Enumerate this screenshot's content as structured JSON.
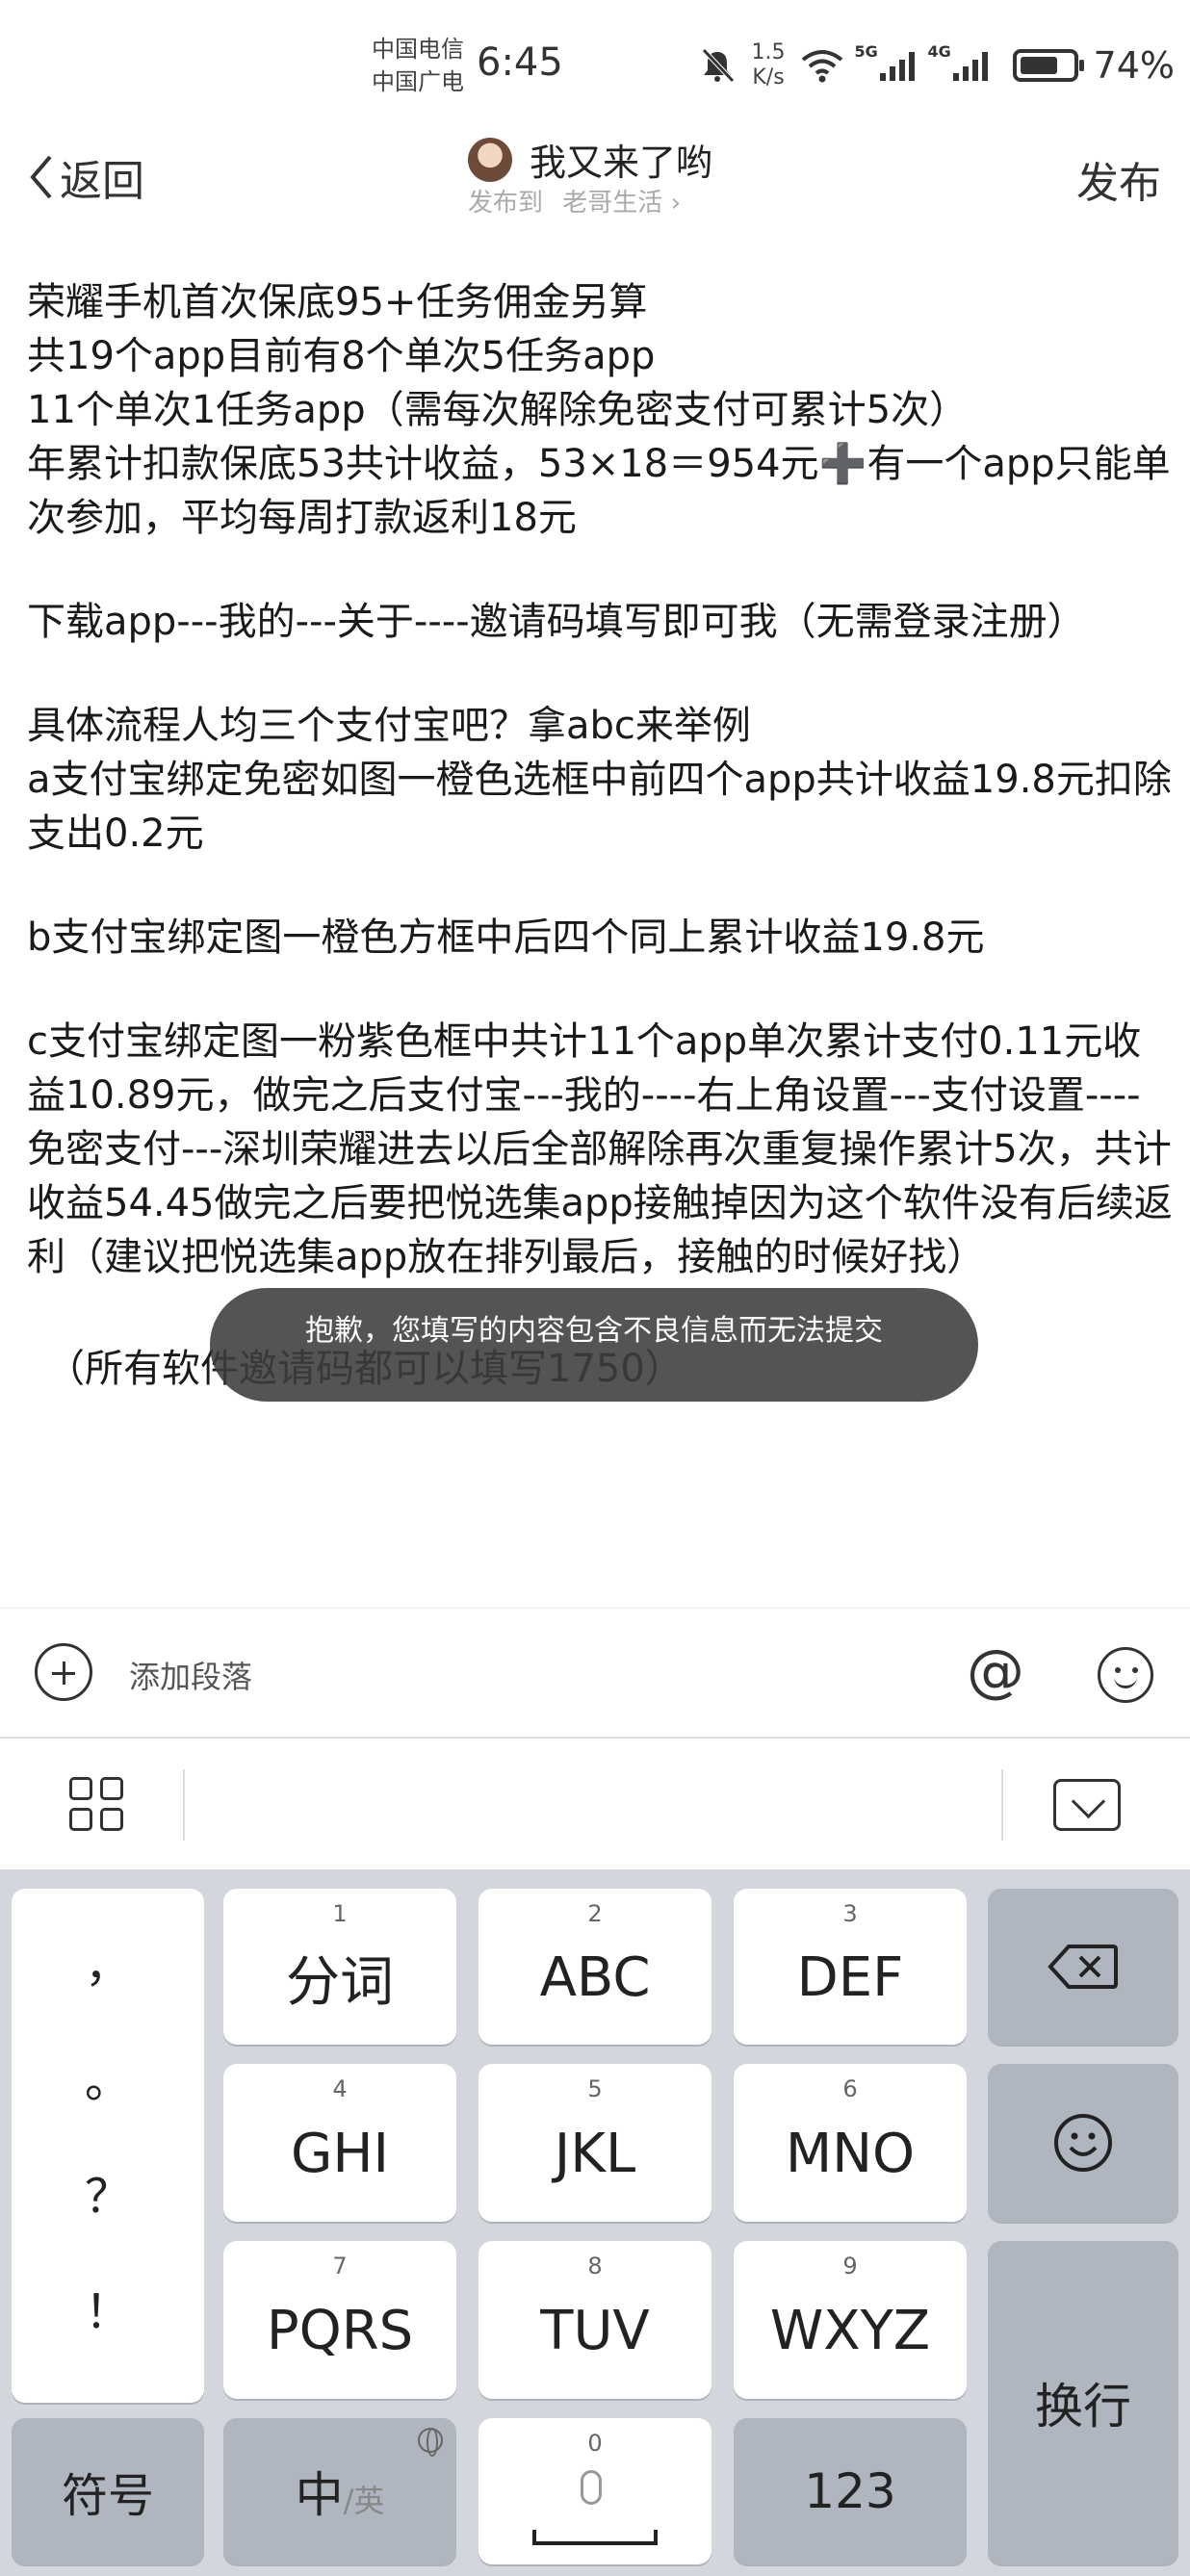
{
  "status_bar": {
    "carrier_1": "中国电信",
    "carrier_2": "中国广电",
    "time": "6:45",
    "net_speed_value": "1.5",
    "net_speed_unit": "K/s",
    "sim1_tag": "5G",
    "sim2_tag": "4G",
    "battery_percent": "74%",
    "battery_level": 0.74,
    "icons": [
      "mute-icon",
      "wifi-icon",
      "signal-5g-icon",
      "signal-4g-icon",
      "battery-icon"
    ]
  },
  "header": {
    "back_label": "返回",
    "author_name": "我又来了哟",
    "publish_to_prefix": "发布到",
    "publish_to_target": "老哥生活",
    "publish_label": "发布"
  },
  "content": {
    "paragraphs": [
      "荣耀手机首次保底95+任务佣金另算\n共19个app目前有8个单次5任务app\n11个单次1任务app（需每次解除免密支付可累计5次）\n年累计扣款保底53共计收益，53×18＝954元➕有一个app只能单次参加，平均每周打款返利18元",
      "下载app---我的---关于----邀请码填写即可我（无需登录注册）",
      "具体流程人均三个支付宝吧？拿abc来举例\na支付宝绑定免密如图一橙色选框中前四个app共计收益19.8元扣除支出0.2元",
      "b支付宝绑定图一橙色方框中后四个同上累计收益19.8元",
      "c支付宝绑定图一粉紫色框中共计11个app单次累计支付0.11元收益10.89元，做完之后支付宝---我的----右上角设置---支付设置----免密支付---深圳荣耀进去以后全部解除再次重复操作累计5次，共计收益54.45做完之后要把悦选集app接触掉因为这个软件没有后续返利（建议把悦选集app放在排列最后，接触的时候好找）",
      "（所有软件邀请码都可以填写1750）"
    ]
  },
  "toast": {
    "message": "抱歉，您填写的内容包含不良信息而无法提交"
  },
  "editor_toolbar": {
    "add_paragraph_label": "添加段落",
    "at_symbol": "@"
  },
  "keyboard": {
    "punctuation": [
      "，",
      "。",
      "？",
      "！"
    ],
    "keys": [
      {
        "num": "1",
        "label": "分词"
      },
      {
        "num": "2",
        "label": "ABC"
      },
      {
        "num": "3",
        "label": "DEF"
      },
      {
        "num": "4",
        "label": "GHI"
      },
      {
        "num": "5",
        "label": "JKL"
      },
      {
        "num": "6",
        "label": "MNO"
      },
      {
        "num": "7",
        "label": "PQRS"
      },
      {
        "num": "8",
        "label": "TUV"
      },
      {
        "num": "9",
        "label": "WXYZ"
      }
    ],
    "enter_label": "换行",
    "symbol_label": "符号",
    "zh_label": "中",
    "en_label": "/英",
    "space_num": "0",
    "num_label": "123"
  }
}
